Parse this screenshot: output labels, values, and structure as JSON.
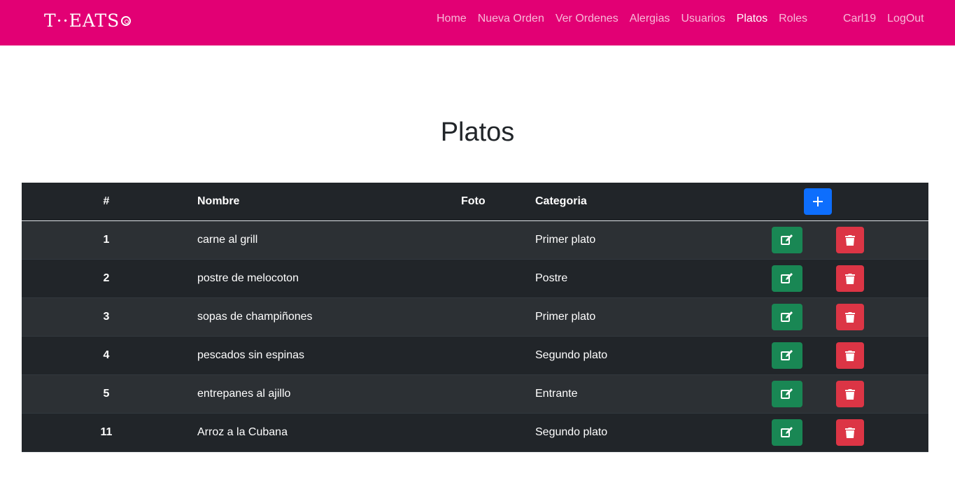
{
  "brand": {
    "name": "T··EATS",
    "icon": "donut-icon"
  },
  "nav": {
    "main": [
      {
        "label": "Home",
        "active": false
      },
      {
        "label": "Nueva Orden",
        "active": false
      },
      {
        "label": "Ver Ordenes",
        "active": false
      },
      {
        "label": "Alergias",
        "active": false
      },
      {
        "label": "Usuarios",
        "active": false
      },
      {
        "label": "Platos",
        "active": true
      },
      {
        "label": "Roles",
        "active": false
      }
    ],
    "user": {
      "username": "Carl19",
      "logout": "LogOut"
    }
  },
  "page": {
    "title": "Platos"
  },
  "table": {
    "headers": {
      "num": "#",
      "name": "Nombre",
      "foto": "Foto",
      "category": "Categoria",
      "add_icon": "plus-icon"
    },
    "rows": [
      {
        "id": "1",
        "name": "carne al grill",
        "foto": "",
        "category": "Primer plato"
      },
      {
        "id": "2",
        "name": "postre de melocoton",
        "foto": "",
        "category": "Postre"
      },
      {
        "id": "3",
        "name": "sopas de champiñones",
        "foto": "",
        "category": "Primer plato"
      },
      {
        "id": "4",
        "name": "pescados sin espinas",
        "foto": "",
        "category": "Segundo plato"
      },
      {
        "id": "5",
        "name": "entrepanes al ajillo",
        "foto": "",
        "category": "Entrante"
      },
      {
        "id": "11",
        "name": "Arroz a la Cubana",
        "foto": "",
        "category": "Segundo plato"
      }
    ],
    "row_icons": {
      "edit": "edit-icon",
      "delete": "trash-icon"
    }
  },
  "colors": {
    "navbar": "#e20074",
    "table_dark": "#212529",
    "table_striped": "#2c3034",
    "add": "#0d6efd",
    "edit": "#198754",
    "delete": "#dc3545"
  }
}
